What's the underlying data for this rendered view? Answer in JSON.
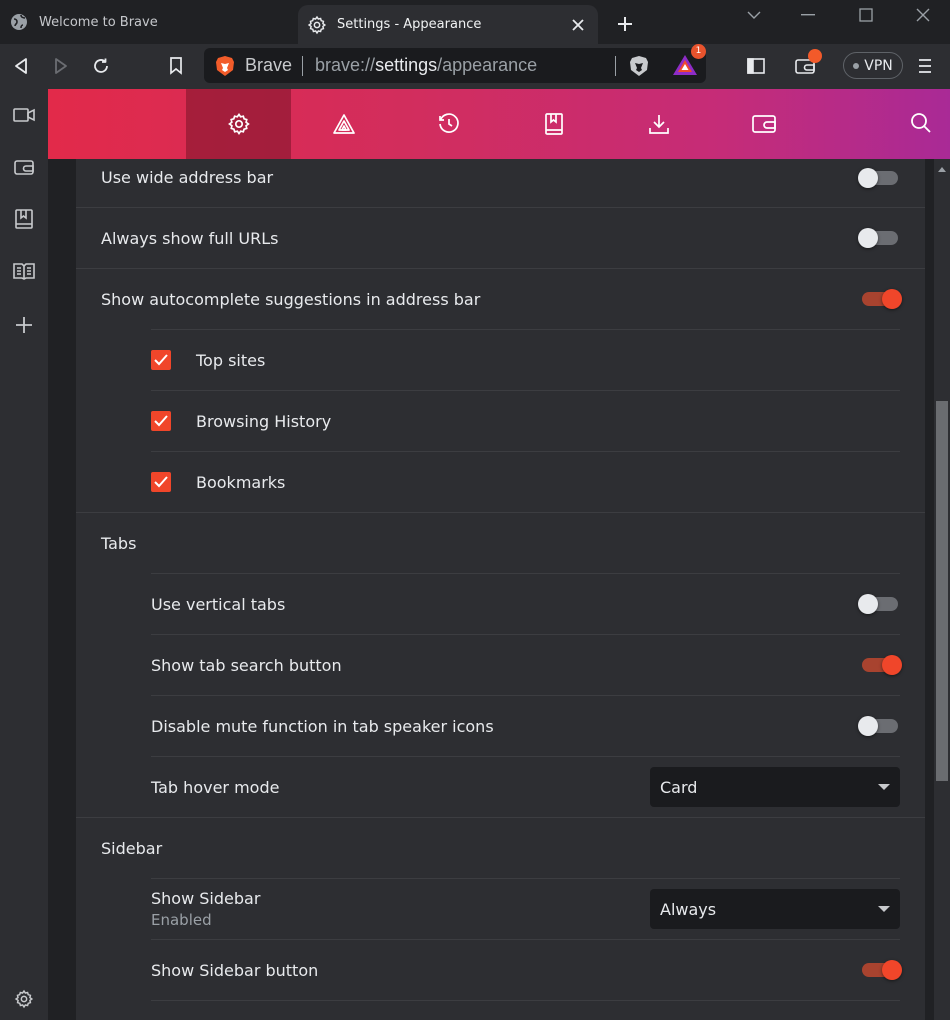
{
  "tabs": [
    {
      "title": "Welcome to Brave",
      "icon": "globe-icon",
      "active": false
    },
    {
      "title": "Settings - Appearance",
      "icon": "gear-icon",
      "active": true
    }
  ],
  "toolbar": {
    "brand_name": "Brave",
    "url_scheme": "brave://",
    "url_host": "settings",
    "url_path": "/appearance",
    "rewards_badge": "1",
    "vpn_label": "VPN"
  },
  "settings_nav": [
    {
      "name": "get-started",
      "icon": "gear-icon",
      "active": true
    },
    {
      "name": "rewards",
      "icon": "rewards-triangle-icon",
      "active": false
    },
    {
      "name": "history",
      "icon": "history-icon",
      "active": false
    },
    {
      "name": "bookmarks",
      "icon": "bookmarks-icon",
      "active": false
    },
    {
      "name": "downloads",
      "icon": "download-icon",
      "active": false
    },
    {
      "name": "wallet",
      "icon": "wallet-icon",
      "active": false
    }
  ],
  "address_bar": {
    "wide_address_bar": {
      "label": "Use wide address bar",
      "enabled": false
    },
    "full_urls": {
      "label": "Always show full URLs",
      "enabled": false
    },
    "autocomplete": {
      "label": "Show autocomplete suggestions in address bar",
      "enabled": true
    },
    "top_sites": {
      "label": "Top sites",
      "checked": true
    },
    "browsing_history": {
      "label": "Browsing History",
      "checked": true
    },
    "bookmarks": {
      "label": "Bookmarks",
      "checked": true
    }
  },
  "tabs_section": {
    "heading": "Tabs",
    "vertical_tabs": {
      "label": "Use vertical tabs",
      "enabled": false
    },
    "tab_search": {
      "label": "Show tab search button",
      "enabled": true
    },
    "disable_mute": {
      "label": "Disable mute function in tab speaker icons",
      "enabled": false
    },
    "hover_mode": {
      "label": "Tab hover mode",
      "value": "Card"
    }
  },
  "sidebar_section": {
    "heading": "Sidebar",
    "show_sidebar": {
      "label": "Show Sidebar",
      "sublabel": "Enabled",
      "value": "Always"
    },
    "sidebar_button": {
      "label": "Show Sidebar button",
      "enabled": true
    }
  },
  "colors": {
    "accent": "#f0462a",
    "header_gradient_start": "#e22a4a",
    "header_gradient_end": "#a92a96",
    "background": "#202124",
    "card": "#2d2e32"
  }
}
